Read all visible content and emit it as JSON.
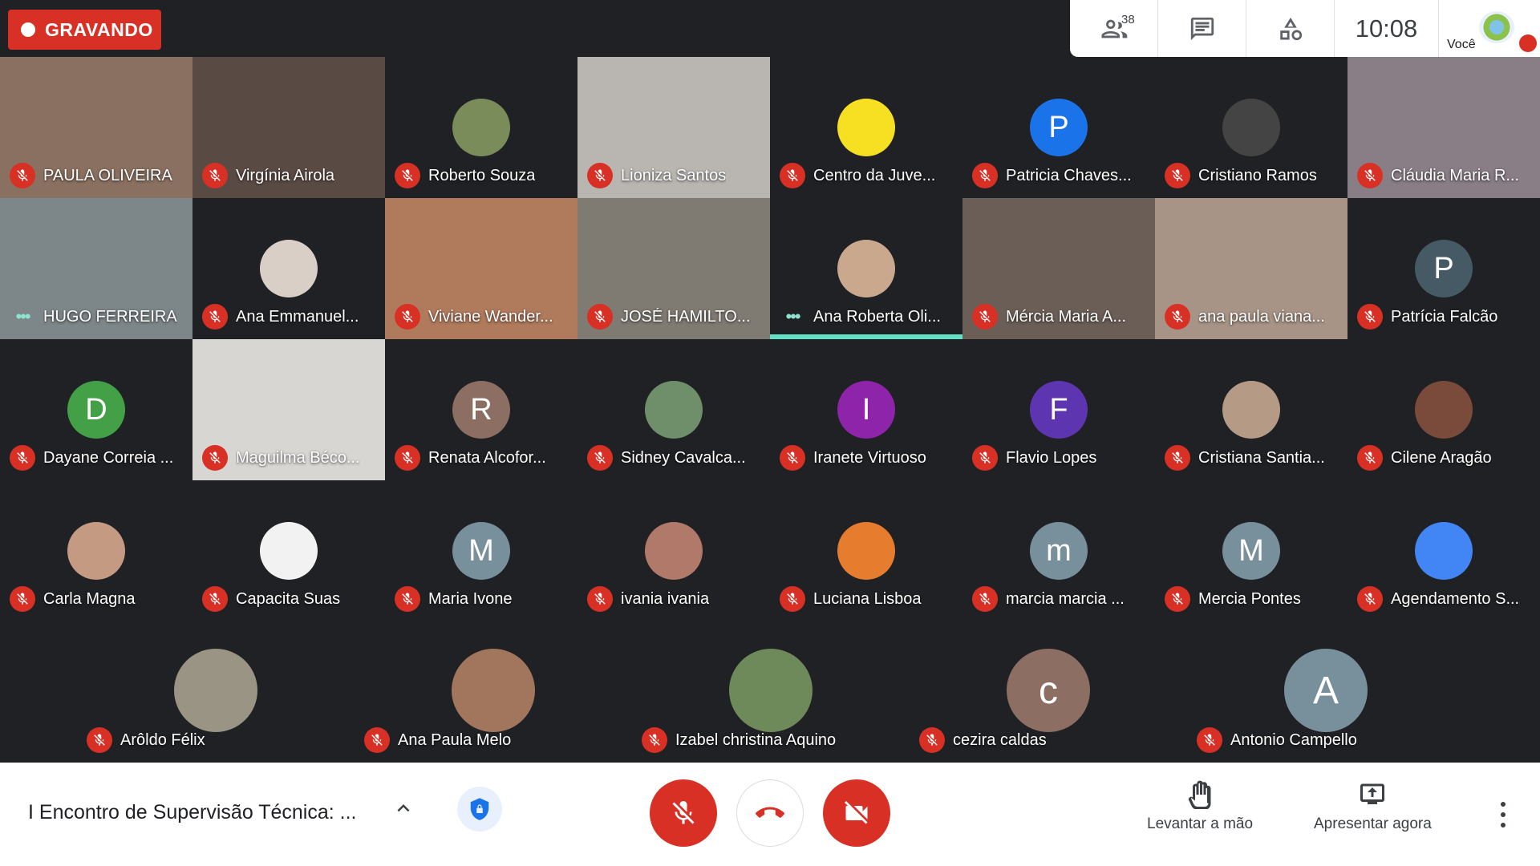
{
  "recording": {
    "label": "GRAVANDO"
  },
  "topbar": {
    "participants_count": "38",
    "time": "10:08",
    "self_label": "Você"
  },
  "participants": [
    {
      "name": "PAULA OLIVEIRA",
      "type": "video",
      "bg": "#8a7060",
      "status": "muted"
    },
    {
      "name": "Virgínia Airola",
      "type": "video",
      "bg": "#5a4a44",
      "status": "muted"
    },
    {
      "name": "Roberto Souza",
      "type": "avatar",
      "avatar_bg": "#7a8c5a",
      "status": "muted"
    },
    {
      "name": "Lioniza Santos",
      "type": "video",
      "bg": "#b9b6b2",
      "status": "muted"
    },
    {
      "name": "Centro da Juve...",
      "type": "avatar",
      "avatar_bg": "#f7e022",
      "status": "muted"
    },
    {
      "name": "Patricia Chaves...",
      "type": "letter",
      "letter": "P",
      "avatar_bg": "#1a73e8",
      "status": "muted"
    },
    {
      "name": "Cristiano Ramos",
      "type": "avatar",
      "avatar_bg": "#444",
      "status": "muted"
    },
    {
      "name": "Cláudia Maria R...",
      "type": "video",
      "bg": "#8a7e86",
      "status": "muted"
    },
    {
      "name": "HUGO FERREIRA",
      "type": "video",
      "bg": "#7d8688",
      "status": "talking"
    },
    {
      "name": "Ana Emmanuel...",
      "type": "avatar",
      "avatar_bg": "#d9cfc6",
      "status": "muted"
    },
    {
      "name": "Viviane Wander...",
      "type": "video",
      "bg": "#b07a5c",
      "status": "muted"
    },
    {
      "name": "JOSÉ HAMILTO...",
      "type": "video",
      "bg": "#7f7a72",
      "status": "muted"
    },
    {
      "name": "Ana Roberta Oli...",
      "type": "avatar",
      "avatar_bg": "#c9a88d",
      "status": "speaking"
    },
    {
      "name": "Mércia Maria A...",
      "type": "video",
      "bg": "#6b5e57",
      "status": "muted"
    },
    {
      "name": "ana paula viana...",
      "type": "video",
      "bg": "#a89486",
      "status": "muted"
    },
    {
      "name": "Patrícia Falcão",
      "type": "letter",
      "letter": "P",
      "avatar_bg": "#455a64",
      "status": "muted"
    },
    {
      "name": "Dayane Correia ...",
      "type": "letter",
      "letter": "D",
      "avatar_bg": "#43a047",
      "status": "muted"
    },
    {
      "name": "Maguilma Béco...",
      "type": "video",
      "bg": "#d8d6d3",
      "status": "muted"
    },
    {
      "name": "Renata Alcofor...",
      "type": "letter",
      "letter": "R",
      "avatar_bg": "#8d6e63",
      "status": "muted"
    },
    {
      "name": "Sidney Cavalca...",
      "type": "avatar",
      "avatar_bg": "#6f8f6a",
      "status": "muted"
    },
    {
      "name": "Iranete Virtuoso",
      "type": "letter",
      "letter": "I",
      "avatar_bg": "#8e24aa",
      "status": "muted"
    },
    {
      "name": "Flavio Lopes",
      "type": "letter",
      "letter": "F",
      "avatar_bg": "#5e35b1",
      "status": "muted"
    },
    {
      "name": "Cristiana Santia...",
      "type": "avatar",
      "avatar_bg": "#b59b86",
      "status": "muted"
    },
    {
      "name": "Cilene Aragão",
      "type": "avatar",
      "avatar_bg": "#7a4a3a",
      "status": "muted"
    },
    {
      "name": "Carla Magna",
      "type": "avatar",
      "avatar_bg": "#c49a83",
      "status": "muted"
    },
    {
      "name": "Capacita Suas",
      "type": "avatar",
      "avatar_bg": "#f2f2f2",
      "status": "muted"
    },
    {
      "name": "Maria Ivone",
      "type": "letter",
      "letter": "M",
      "avatar_bg": "#78909c",
      "status": "muted"
    },
    {
      "name": "ivania ivania",
      "type": "avatar",
      "avatar_bg": "#b0796a",
      "status": "muted"
    },
    {
      "name": "Luciana Lisboa",
      "type": "avatar",
      "avatar_bg": "#e57c2e",
      "status": "muted"
    },
    {
      "name": "marcia marcia ...",
      "type": "letter",
      "letter": "m",
      "avatar_bg": "#78909c",
      "status": "muted"
    },
    {
      "name": "Mercia Pontes",
      "type": "letter",
      "letter": "M",
      "avatar_bg": "#78909c",
      "status": "muted"
    },
    {
      "name": "Agendamento S...",
      "type": "avatar",
      "avatar_bg": "#4285f4",
      "status": "muted"
    },
    {
      "name": "Arôldo Félix",
      "type": "avatar",
      "avatar_bg": "#9a9484",
      "status": "muted"
    },
    {
      "name": "Ana Paula Melo",
      "type": "avatar",
      "avatar_bg": "#a2765c",
      "status": "muted"
    },
    {
      "name": "Izabel christina Aquino",
      "type": "avatar",
      "avatar_bg": "#6e8a5a",
      "status": "muted"
    },
    {
      "name": "cezira caldas",
      "type": "letter",
      "letter": "c",
      "avatar_bg": "#8d6e63",
      "status": "muted"
    },
    {
      "name": "Antonio Campello",
      "type": "letter",
      "letter": "A",
      "avatar_bg": "#78909c",
      "status": "muted"
    }
  ],
  "bottom": {
    "meeting_title": "I Encontro de Supervisão Técnica: ...",
    "raise_hand": "Levantar a mão",
    "present_now": "Apresentar agora"
  },
  "colors": {
    "danger": "#d93025",
    "speaking": "#64e0c4"
  }
}
